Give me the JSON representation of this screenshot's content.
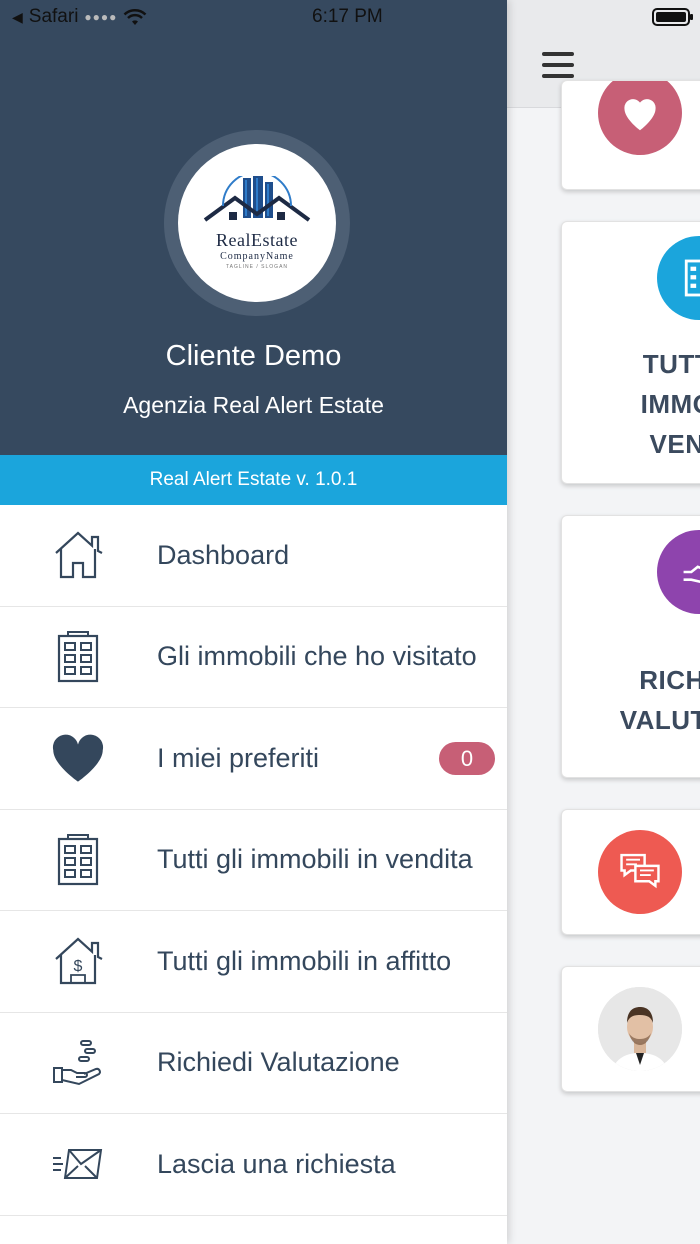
{
  "status_bar": {
    "back_app": "Safari",
    "time": "6:17 PM"
  },
  "drawer": {
    "logo": {
      "line1": "RealEstate",
      "line2": "CompanyName",
      "line3": "TAGLINE / SLOGAN"
    },
    "user_name": "Cliente Demo",
    "agency_name": "Agenzia Real Alert Estate",
    "version": "Real Alert Estate v. 1.0.1",
    "menu": [
      {
        "label": "Dashboard",
        "icon": "home-icon"
      },
      {
        "label": "Gli immobili che ho visitato",
        "icon": "building-icon"
      },
      {
        "label": "I miei preferiti",
        "icon": "heart-icon",
        "badge": "0"
      },
      {
        "label": "Tutti gli immobili in vendita",
        "icon": "building-icon"
      },
      {
        "label": "Tutti gli immobili in affitto",
        "icon": "house-dollar-icon"
      },
      {
        "label": "Richiedi Valutazione",
        "icon": "hand-coins-icon"
      },
      {
        "label": "Lascia una richiesta",
        "icon": "mail-icon"
      }
    ]
  },
  "main": {
    "cards": [
      {
        "text": "",
        "icon": "heart-icon",
        "color": "#c75f76"
      },
      {
        "text": "TUTT\nIMMO\nVEN",
        "icon": "building-icon",
        "color": "#1ba5dc"
      },
      {
        "text": "RICH\nVALUTA",
        "icon": "hand-icon",
        "color": "#8e44ad"
      },
      {
        "text": "",
        "icon": "chat-icon",
        "color": "#ee5a52"
      },
      {
        "text": "",
        "icon": "agent-avatar",
        "color": "#e5e5e5"
      }
    ]
  },
  "colors": {
    "header_bg": "#36495f",
    "accent": "#1ba5dc",
    "badge": "#c75f76",
    "text": "#34475c"
  }
}
